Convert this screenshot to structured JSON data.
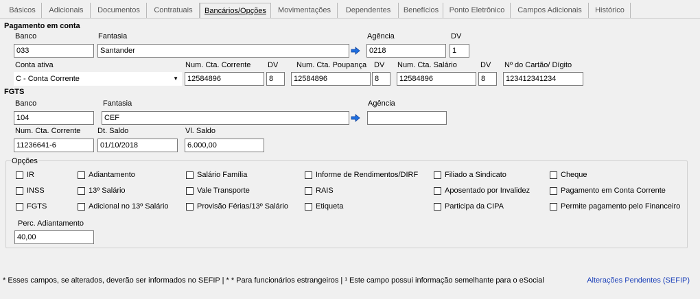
{
  "tabs": [
    "Básicos",
    "Adicionais",
    "Documentos",
    "Contratuais",
    "Bancários/Opções",
    "Movimentações",
    "Dependentes",
    "Benefícios",
    "Ponto Eletrônico",
    "Campos Adicionais",
    "Histórico"
  ],
  "pagamento": {
    "section_title": "Pagamento em conta",
    "banco_label": "Banco",
    "banco_value": "033",
    "fantasia_label": "Fantasia",
    "fantasia_value": "Santander",
    "agencia_label": "Agência",
    "agencia_value": "0218",
    "dv_label": "DV",
    "dv_value": "1",
    "conta_ativa_label": "Conta ativa",
    "conta_ativa_value": "C - Conta Corrente",
    "cta_corrente_label": "Num. Cta. Corrente",
    "cta_corrente_value": "12584896",
    "dv1_label": "DV",
    "dv1_value": "8",
    "cta_poupanca_label": "Num. Cta. Poupança",
    "cta_poupanca_value": "12584896",
    "dv2_label": "DV",
    "dv2_value": "8",
    "cta_salario_label": "Num. Cta. Salário",
    "cta_salario_value": "12584896",
    "dv3_label": "DV",
    "dv3_value": "8",
    "cartao_label": "Nº do Cartão/ Dígito",
    "cartao_value": "123412341234"
  },
  "fgts": {
    "section_title": "FGTS",
    "banco_label": "Banco",
    "banco_value": "104",
    "fantasia_label": "Fantasia",
    "fantasia_value": "CEF",
    "agencia_label": "Agência",
    "agencia_value": "",
    "cta_corrente_label": "Num. Cta. Corrente",
    "cta_corrente_value": "11236641-6",
    "dt_saldo_label": "Dt. Saldo",
    "dt_saldo_value": "01/10/2018",
    "vl_saldo_label": "Vl. Saldo",
    "vl_saldo_value": "6.000,00"
  },
  "opcoes": {
    "title": "Opções",
    "checkboxes": [
      "IR",
      "INSS",
      "FGTS",
      "Adiantamento",
      "13º Salário",
      "Adicional no 13º Salário",
      "Salário Família",
      "Vale Transporte",
      "Provisão Férias/13º Salário",
      "Informe de Rendimentos/DIRF",
      "RAIS",
      "Etiqueta",
      "Filiado a Sindicato",
      "Aposentado por Invalidez",
      "Participa da CIPA",
      "Cheque",
      "Pagamento em Conta Corrente",
      "Permite pagamento pelo Financeiro"
    ],
    "perc_label": "Perc. Adiantamento",
    "perc_value": "40,00"
  },
  "footer": {
    "note": "* Esses campos, se alterados, deverão ser informados no SEFIP | * * Para funcionários estrangeiros |  ¹  Este campo possui informação semelhante para o eSocial",
    "link": "Alterações Pendentes (SEFIP)"
  },
  "colors": {
    "link": "#1a3fb8",
    "arrow_icon": "#1f6fe0"
  }
}
